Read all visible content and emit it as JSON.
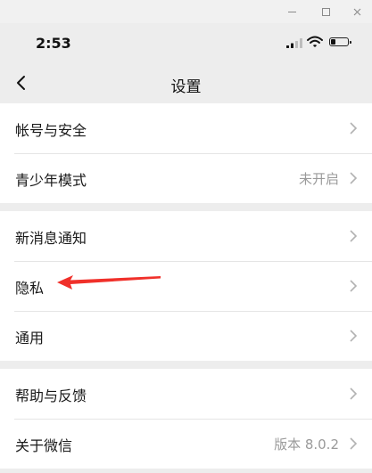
{
  "status": {
    "time": "2:53"
  },
  "nav": {
    "title": "设置"
  },
  "groups": [
    {
      "rows": [
        {
          "label": "帐号与安全",
          "value": ""
        },
        {
          "label": "青少年模式",
          "value": "未开启"
        }
      ]
    },
    {
      "rows": [
        {
          "label": "新消息通知",
          "value": ""
        },
        {
          "label": "隐私",
          "value": ""
        },
        {
          "label": "通用",
          "value": ""
        }
      ]
    },
    {
      "rows": [
        {
          "label": "帮助与反馈",
          "value": ""
        },
        {
          "label": "关于微信",
          "value": "版本 8.0.2"
        }
      ]
    }
  ],
  "colors": {
    "annotation_arrow": "#f0302a",
    "background": "#ededed",
    "card": "#ffffff"
  }
}
